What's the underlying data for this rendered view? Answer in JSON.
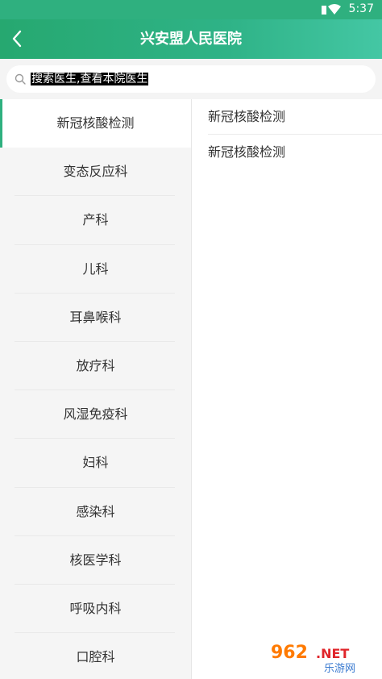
{
  "status_bar": {
    "time": "5:37"
  },
  "app_bar": {
    "title": "兴安盟人民医院"
  },
  "search": {
    "placeholder": "搜索医生,查看本院医生"
  },
  "departments": [
    "新冠核酸检测",
    "变态反应科",
    "产科",
    "儿科",
    "耳鼻喉科",
    "放疗科",
    "风湿免疫科",
    "妇科",
    "感染科",
    "核医学科",
    "呼吸内科",
    "口腔科"
  ],
  "selected_department_index": 0,
  "services": [
    "新冠核酸检测",
    "新冠核酸检测"
  ],
  "watermark": {
    "number": "962",
    "domain": ".NET",
    "subtitle": "乐游网"
  },
  "colors": {
    "accent": "#2fb07f",
    "header_end": "#44c7a4",
    "panel_bg": "#f5f5f5"
  }
}
